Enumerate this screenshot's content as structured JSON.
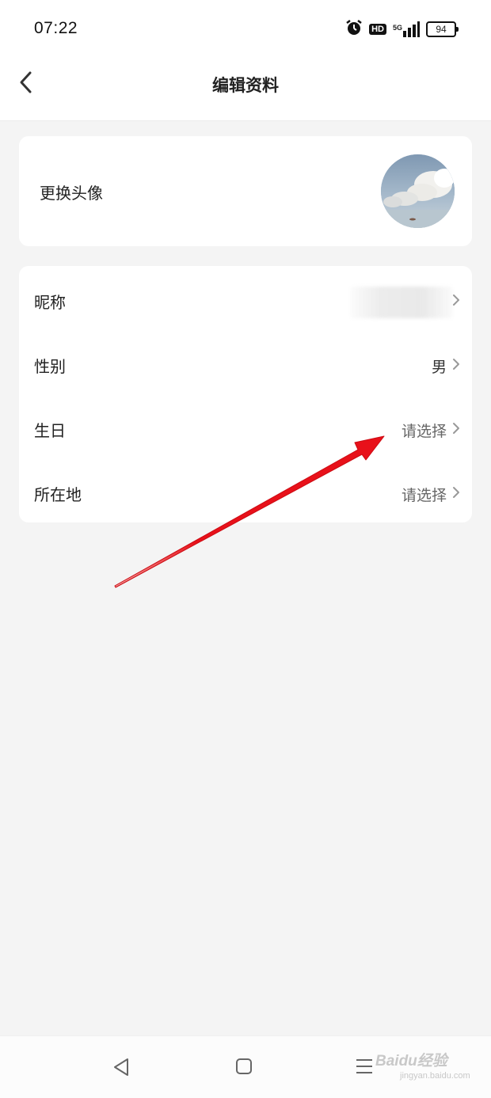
{
  "status_bar": {
    "time": "07:22",
    "hd": "HD",
    "network": "5G",
    "battery": "94",
    "icons": [
      "alarm-icon",
      "hd-icon",
      "signal-icon",
      "battery-icon"
    ]
  },
  "header": {
    "title": "编辑资料",
    "back_icon": "chevron-left-icon"
  },
  "avatar_section": {
    "label": "更换头像"
  },
  "fields": [
    {
      "label": "昵称",
      "value": ""
    },
    {
      "label": "性别",
      "value": "男"
    },
    {
      "label": "生日",
      "value": "请选择"
    },
    {
      "label": "所在地",
      "value": "请选择"
    }
  ],
  "system_nav": {
    "icons": [
      "back-triangle-icon",
      "home-square-icon",
      "menu-lines-icon"
    ]
  },
  "watermark": {
    "brand": "Baidu经验",
    "url": "jingyan.baidu.com"
  },
  "colors": {
    "annotation_arrow": "#e8111a",
    "page_background": "#f4f4f4",
    "card_background": "#ffffff"
  }
}
